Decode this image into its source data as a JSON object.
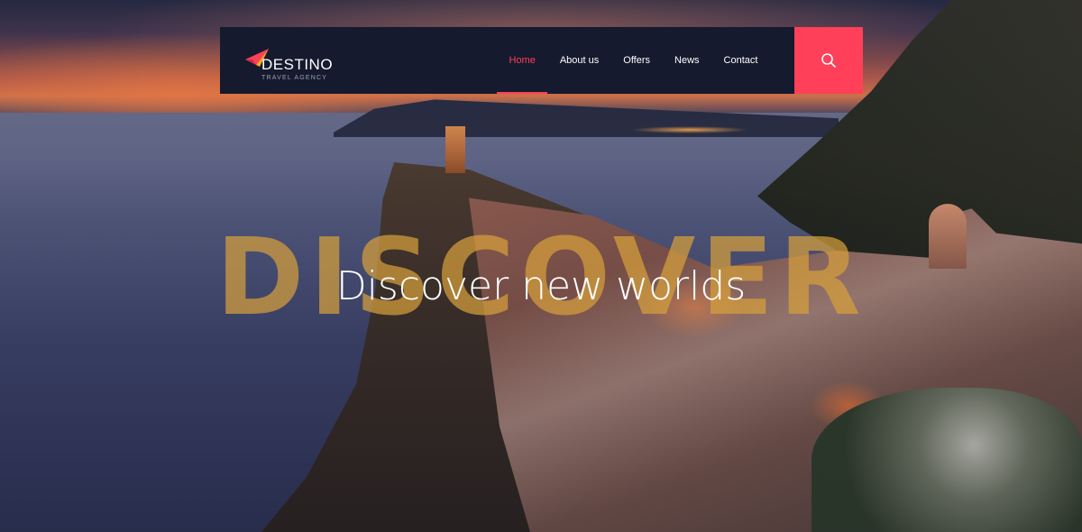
{
  "brand": {
    "name": "DESTINO",
    "tagline": "TRAVEL AGENCY",
    "logo_icon": "paper-plane-icon",
    "accent": "#ff4058",
    "secondary": "#f5a623"
  },
  "nav": {
    "items": [
      {
        "label": "Home",
        "active": true
      },
      {
        "label": "About us",
        "active": false
      },
      {
        "label": "Offers",
        "active": false
      },
      {
        "label": "News",
        "active": false
      },
      {
        "label": "Contact",
        "active": false
      }
    ],
    "search_icon": "search-icon"
  },
  "hero": {
    "watermark": "DISCOVER",
    "headline": "Discover new worlds"
  },
  "colors": {
    "navbar_bg": "#151a2e",
    "watermark": "#d6a03c"
  }
}
